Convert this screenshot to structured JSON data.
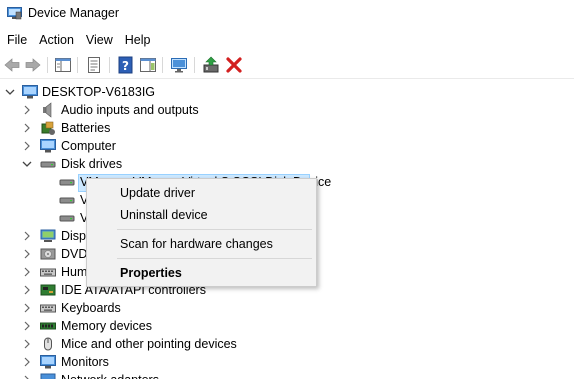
{
  "window": {
    "title": "Device Manager"
  },
  "menu": [
    "File",
    "Action",
    "View",
    "Help"
  ],
  "toolbar": [
    "back",
    "forward",
    "show-hide-console-tree",
    "properties",
    "help",
    "show-action-pane",
    "scan-for-hardware-changes",
    "update-driver",
    "uninstall-device"
  ],
  "tree": {
    "root": "DESKTOP-V6183IG",
    "items": [
      {
        "label": "Audio inputs and outputs",
        "icon": "speaker-icon"
      },
      {
        "label": "Batteries",
        "icon": "battery-icon"
      },
      {
        "label": "Computer",
        "icon": "computer-icon"
      },
      {
        "label": "Disk drives",
        "icon": "disk-drive-icon",
        "expanded": true
      },
      {
        "label": "VMware, VMware Virtual S SCSI Disk Device",
        "icon": "disk-drive-icon",
        "child": true,
        "selected": true
      },
      {
        "label": "V",
        "icon": "disk-drive-icon",
        "child": true
      },
      {
        "label": "V",
        "icon": "disk-drive-icon",
        "child": true
      },
      {
        "label": "Disp",
        "icon": "display-adapter-icon"
      },
      {
        "label": "DVD",
        "icon": "dvd-drive-icon"
      },
      {
        "label": "Hum",
        "icon": "hid-icon"
      },
      {
        "label": "IDE ATA/ATAPI controllers",
        "icon": "ide-controller-icon"
      },
      {
        "label": "Keyboards",
        "icon": "keyboard-icon"
      },
      {
        "label": "Memory devices",
        "icon": "memory-icon"
      },
      {
        "label": "Mice and other pointing devices",
        "icon": "mouse-icon"
      },
      {
        "label": "Monitors",
        "icon": "monitor-icon"
      },
      {
        "label": "Network adapters",
        "icon": "network-icon"
      }
    ]
  },
  "context_menu": {
    "update_driver": "Update driver",
    "uninstall_device": "Uninstall device",
    "scan": "Scan for hardware changes",
    "properties": "Properties"
  },
  "colors": {
    "selection": "#cce8ff",
    "selection_border": "#99d1ff",
    "uninstall_red": "#d32020"
  }
}
